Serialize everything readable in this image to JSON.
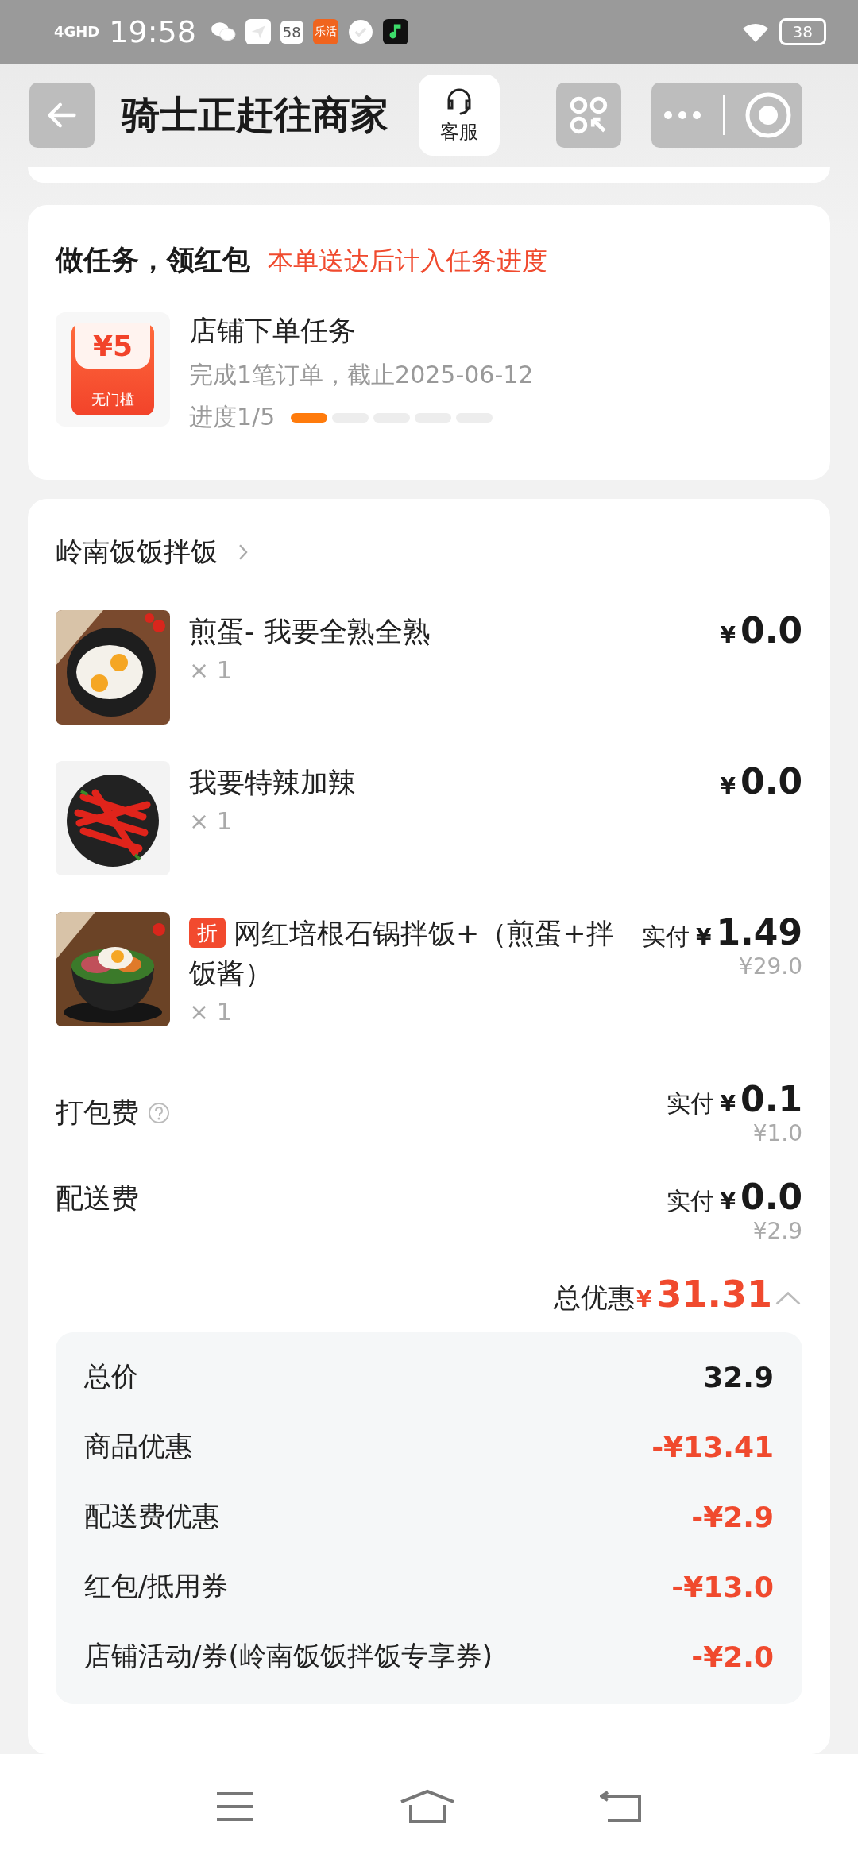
{
  "status_bar": {
    "network": "4GHD",
    "time": "19:58",
    "icons": [
      {
        "kind": "chat"
      },
      {
        "kind": "send"
      },
      {
        "kind": "badge",
        "text": "58"
      },
      {
        "kind": "app",
        "text": "乐活"
      },
      {
        "kind": "check"
      },
      {
        "kind": "music"
      }
    ],
    "battery": "38"
  },
  "header": {
    "title": "骑士正赶往商家",
    "service_label": "客服"
  },
  "task_card": {
    "title": "做任务，领红包",
    "note": "本单送达后计入任务进度",
    "coupon": {
      "amount": "¥5",
      "label": "无门槛"
    },
    "task_name": "店铺下单任务",
    "description": "完成1笔订单，截止2025-06-12",
    "progress_label": "进度1/5",
    "segments": [
      {
        "done": true
      },
      {
        "done": false
      },
      {
        "done": false
      },
      {
        "done": false
      },
      {
        "done": false
      }
    ]
  },
  "store": {
    "name": "岭南饭饭拌饭",
    "items": [
      {
        "kind": "egg",
        "name": "煎蛋- 我要全熟全熟",
        "quantity": "× 1",
        "currency": "¥",
        "price": "0.0"
      },
      {
        "kind": "chili",
        "name": "我要特辣加辣",
        "quantity": "× 1",
        "currency": "¥",
        "price": "0.0"
      },
      {
        "kind": "bowl",
        "tag": "折",
        "name": "网红培根石锅拌饭+（煎蛋+拌饭酱）",
        "quantity": "× 1",
        "paid_label": "实付",
        "currency": "¥",
        "price": "1.49",
        "original_price": "¥29.0"
      }
    ],
    "fees": [
      {
        "name": "打包费",
        "help": true,
        "paid_label": "实付",
        "currency": "¥",
        "price": "0.1",
        "original_price": "¥1.0"
      },
      {
        "name": "配送费",
        "paid_label": "实付",
        "currency": "¥",
        "price": "0.0",
        "original_price": "¥2.9"
      }
    ],
    "total_discount": {
      "label": "总优惠",
      "currency": "¥",
      "amount": "31.31",
      "expanded": true
    },
    "summary": [
      {
        "label": "总价",
        "value": "32.9",
        "discount": false
      },
      {
        "label": "商品优惠",
        "value": "-¥13.41",
        "discount": true
      },
      {
        "label": "配送费优惠",
        "value": "-¥2.9",
        "discount": true
      },
      {
        "label": "红包/抵用券",
        "value": "-¥13.0",
        "discount": true
      },
      {
        "label": "店铺活动/券(岭南饭饭拌饭专享券)",
        "value": "-¥2.0",
        "discount": true
      }
    ]
  }
}
